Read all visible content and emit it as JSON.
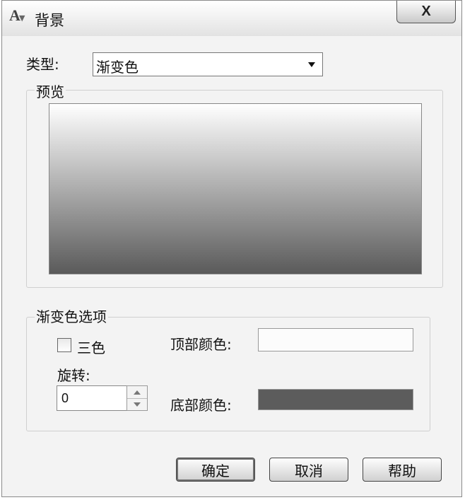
{
  "window": {
    "title": "背景",
    "close_label": "X"
  },
  "type_row": {
    "label": "类型:",
    "selected": "渐变色"
  },
  "preview": {
    "title": "预览",
    "gradient_top": "#ffffff",
    "gradient_bottom": "#5a5a5a"
  },
  "gradient_options": {
    "title": "渐变色选项",
    "three_color": {
      "label": "三色",
      "checked": false
    },
    "rotation": {
      "label": "旋转:",
      "value": "0"
    },
    "top_color": {
      "label": "顶部颜色:",
      "color": "#fcfcfc"
    },
    "bottom_color": {
      "label": "底部颜色:",
      "color": "#5c5c5c"
    }
  },
  "buttons": {
    "ok": "确定",
    "cancel": "取消",
    "help": "帮助"
  }
}
